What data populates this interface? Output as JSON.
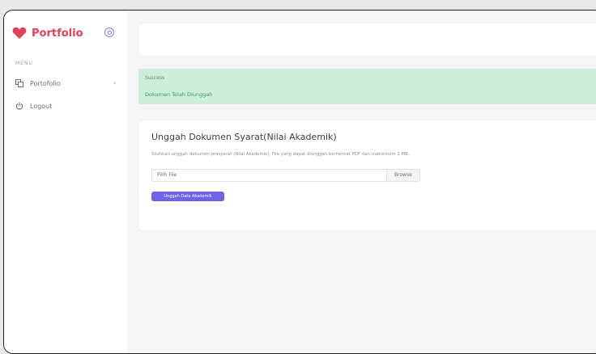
{
  "sidebar": {
    "brand": "Portfolio",
    "menu_header": "MENU",
    "items": [
      {
        "label": "Portofolio",
        "icon": "copy-icon"
      },
      {
        "label": "Logout",
        "icon": "power-icon"
      }
    ]
  },
  "alert": {
    "title": "Success",
    "message": "Dokumen Telah Diunggah"
  },
  "upload": {
    "title": "Unggah Dokumen Syarat(Nilai Akademik)",
    "description": "Silahkan unggah dokumen prasyarat (Nilai Akademik). File yang dapat diunggah berformat PDF dan maksimum 2 MB.",
    "file_placeholder": "Pilih File",
    "browse_label": "Browse",
    "submit_label": "Unggah Data Akademik"
  },
  "colors": {
    "brand": "#e0435a",
    "accent": "#6c63e8",
    "success_bg": "#cdeed9",
    "success_text": "#3c9a63"
  }
}
